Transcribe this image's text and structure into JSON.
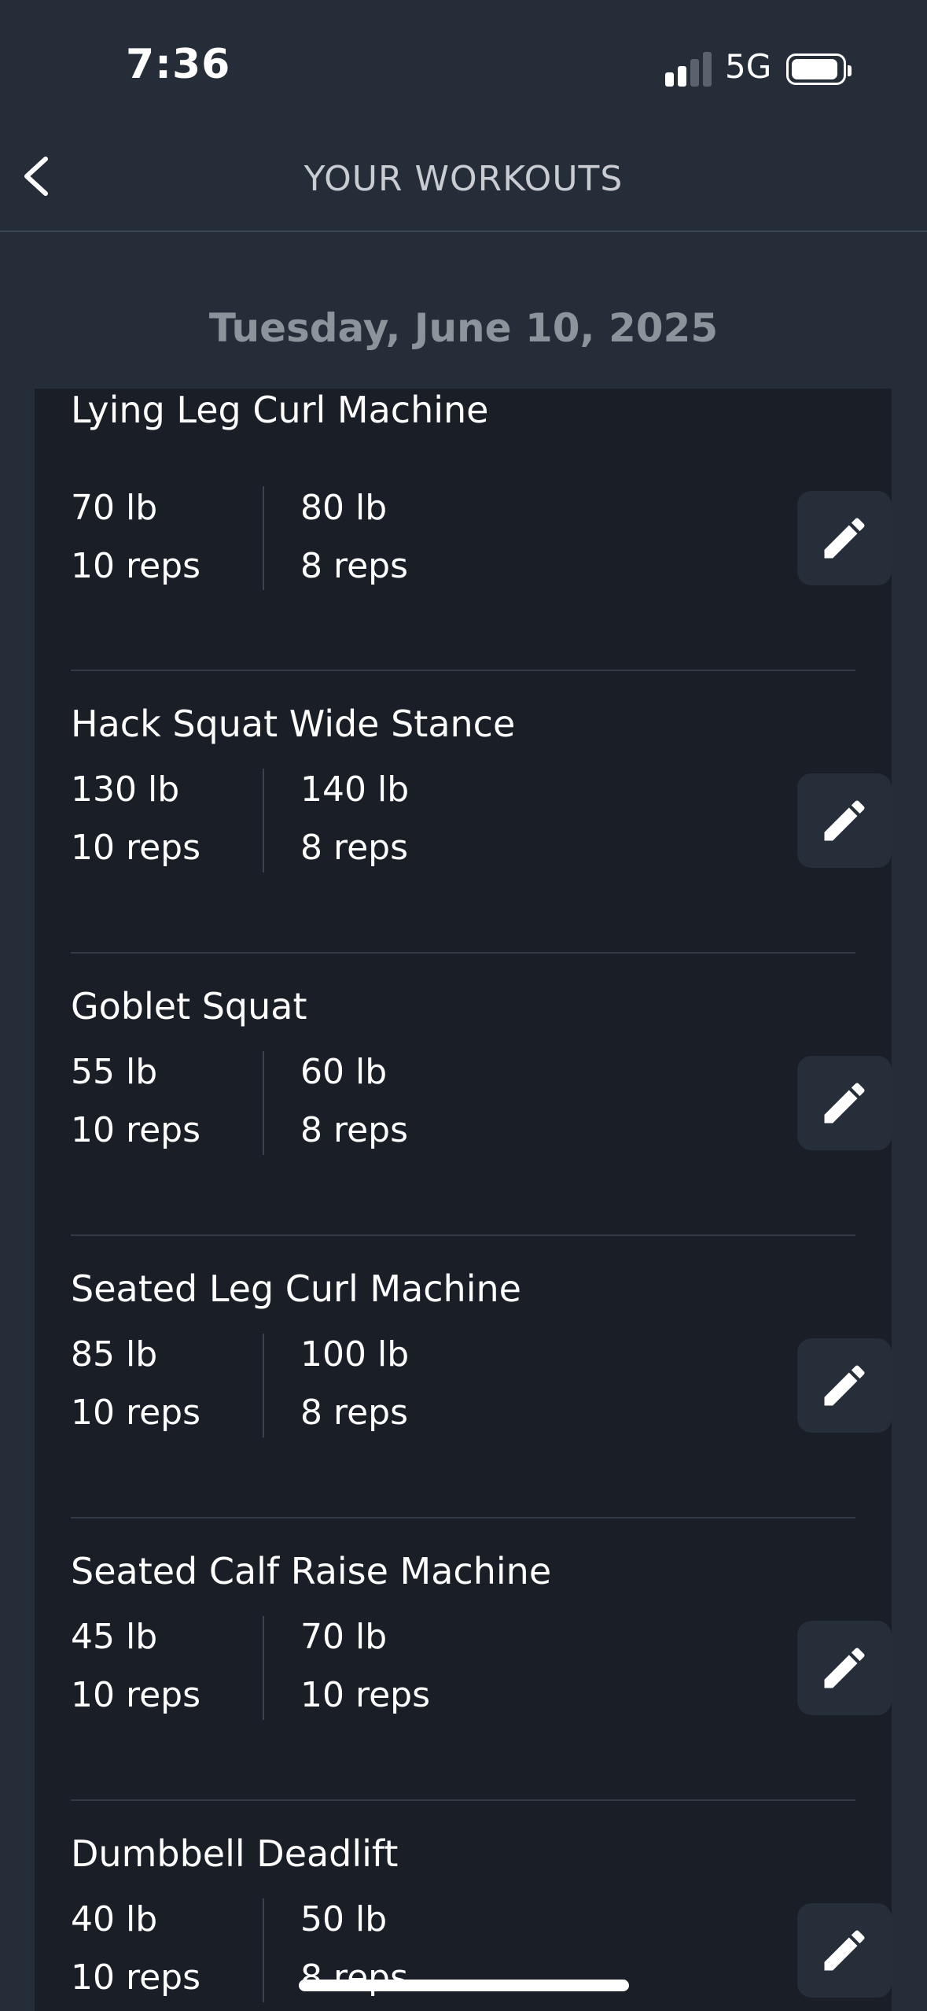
{
  "status_bar": {
    "time": "7:36",
    "network": "5G"
  },
  "nav": {
    "title": "YOUR WORKOUTS",
    "back_icon": "chevron-left-icon"
  },
  "date_header": "Tuesday, June 10, 2025",
  "colors": {
    "background": "#252d38",
    "card": "#1a1f27",
    "edit_button": "#262e39",
    "muted_text": "#8d939b"
  },
  "exercises": [
    {
      "name": "Lying Leg Curl Machine",
      "sets": [
        {
          "weight": "70 lb",
          "reps": "10 reps"
        },
        {
          "weight": "80 lb",
          "reps": "8 reps"
        }
      ]
    },
    {
      "name": "Hack Squat Wide Stance",
      "sets": [
        {
          "weight": "130 lb",
          "reps": "10 reps"
        },
        {
          "weight": "140 lb",
          "reps": "8 reps"
        }
      ]
    },
    {
      "name": "Goblet Squat",
      "sets": [
        {
          "weight": "55 lb",
          "reps": "10 reps"
        },
        {
          "weight": "60 lb",
          "reps": "8 reps"
        }
      ]
    },
    {
      "name": "Seated Leg Curl Machine",
      "sets": [
        {
          "weight": "85 lb",
          "reps": "10 reps"
        },
        {
          "weight": "100 lb",
          "reps": "8 reps"
        }
      ]
    },
    {
      "name": "Seated Calf Raise Machine",
      "sets": [
        {
          "weight": "45 lb",
          "reps": "10 reps"
        },
        {
          "weight": "70 lb",
          "reps": "10 reps"
        }
      ]
    },
    {
      "name": "Dumbbell Deadlift",
      "sets": [
        {
          "weight": "40 lb",
          "reps": "10 reps"
        },
        {
          "weight": "50 lb",
          "reps": "8 reps"
        }
      ]
    }
  ]
}
